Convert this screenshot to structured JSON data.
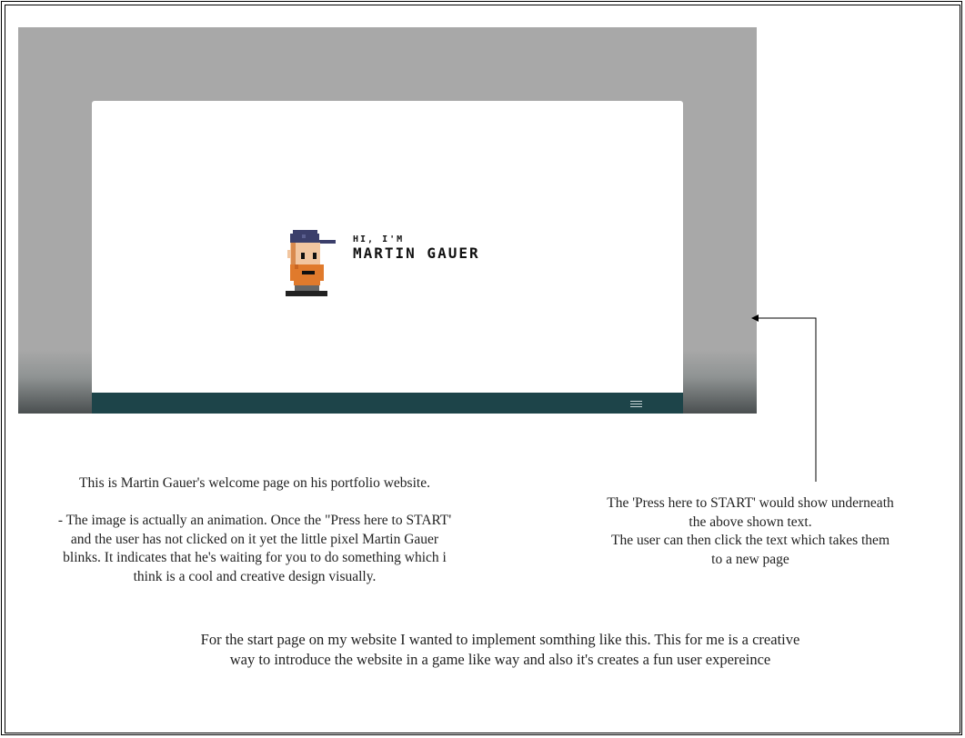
{
  "screenshot": {
    "greeting": "HI, I'M",
    "name": "MARTIN GAUER",
    "menu_icon": "hamburger-menu-icon",
    "colors": {
      "backdrop": "#a8a8a8",
      "card": "#ffffff",
      "footer_bar": "#1d4449"
    }
  },
  "annotations": {
    "left": {
      "intro": "This is Martin Gauer's welcome page on his portfolio website.",
      "lines": [
        "- The image is actually an animation. Once the \"Press here to START'",
        "and the user has not clicked on it yet the little pixel Martin Gauer",
        "blinks. It indicates that he's waiting for you to do something which i",
        "think is a cool and creative design visually."
      ]
    },
    "right": {
      "lines": [
        "The 'Press here to START' would show underneath",
        "the above shown text.",
        "The user can then click the text which takes them",
        "to a new page"
      ]
    },
    "bottom": {
      "lines": [
        "For the start page on my website  I wanted to implement somthing like this. This for me is a creative",
        "way to introduce the website in a game like way and also it's creates a fun user expereince"
      ]
    }
  }
}
